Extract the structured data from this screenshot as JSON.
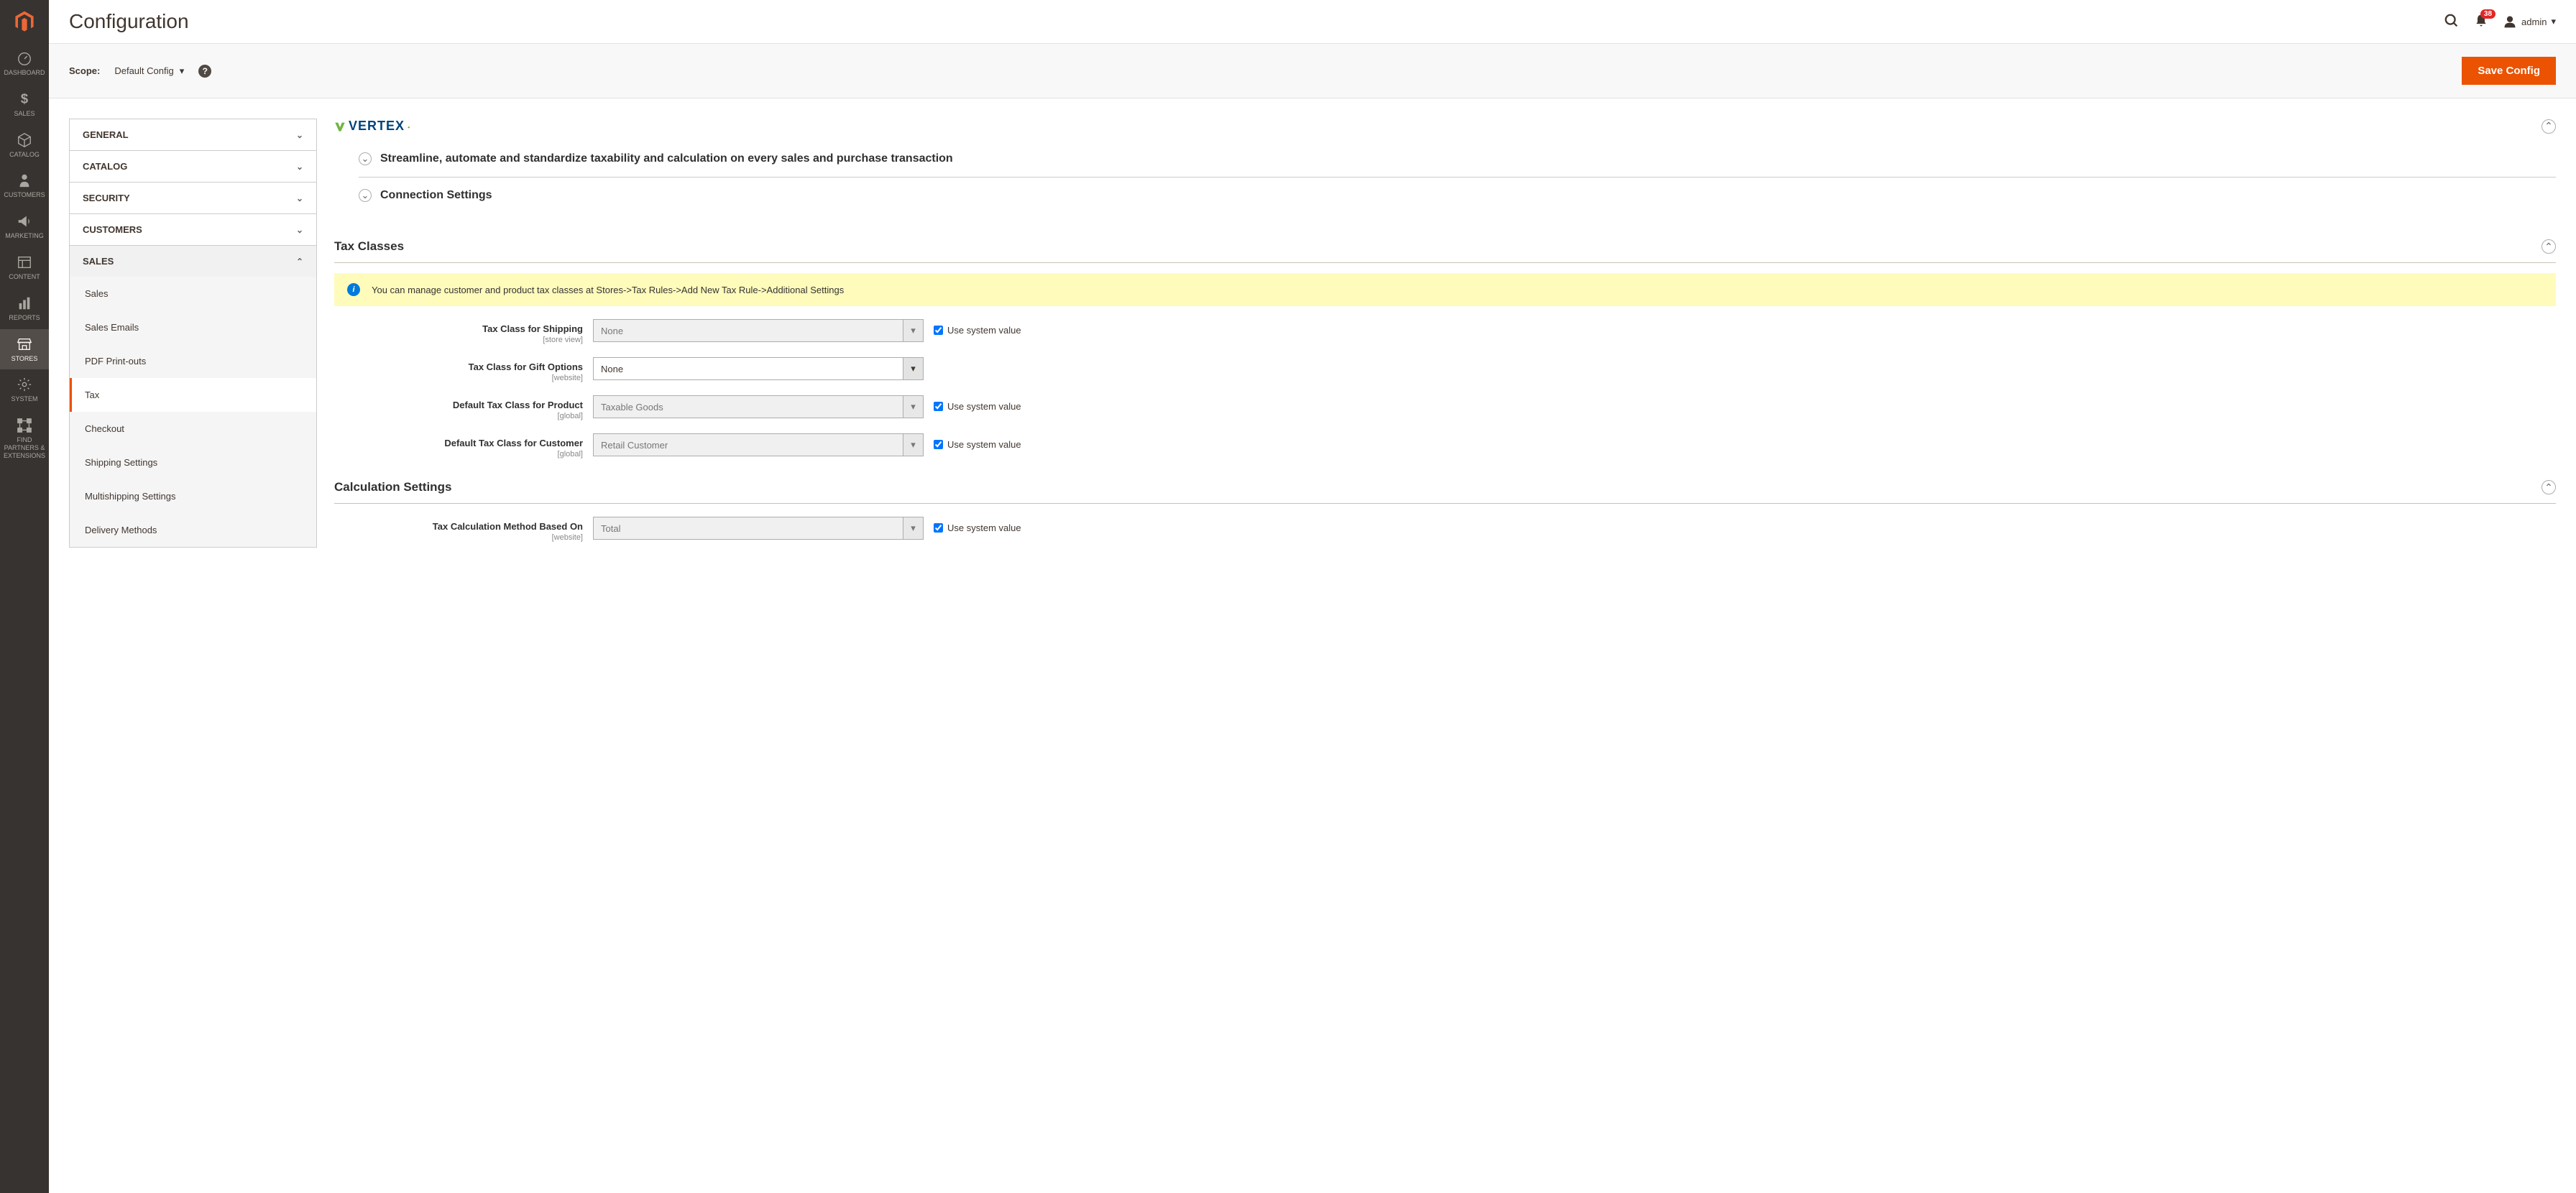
{
  "page_title": "Configuration",
  "header": {
    "notification_count": "38",
    "admin_label": "admin"
  },
  "scope": {
    "label": "Scope:",
    "value": "Default Config",
    "save_button": "Save Config"
  },
  "nav": [
    {
      "label": "DASHBOARD",
      "icon": "dashboard"
    },
    {
      "label": "SALES",
      "icon": "sales"
    },
    {
      "label": "CATALOG",
      "icon": "catalog"
    },
    {
      "label": "CUSTOMERS",
      "icon": "customers"
    },
    {
      "label": "MARKETING",
      "icon": "marketing"
    },
    {
      "label": "CONTENT",
      "icon": "content"
    },
    {
      "label": "REPORTS",
      "icon": "reports"
    },
    {
      "label": "STORES",
      "icon": "stores",
      "active": true
    },
    {
      "label": "SYSTEM",
      "icon": "system"
    },
    {
      "label": "FIND PARTNERS & EXTENSIONS",
      "icon": "partners"
    }
  ],
  "config_sections": [
    {
      "label": "GENERAL"
    },
    {
      "label": "CATALOG"
    },
    {
      "label": "SECURITY"
    },
    {
      "label": "CUSTOMERS"
    },
    {
      "label": "SALES",
      "expanded": true,
      "items": [
        {
          "label": "Sales"
        },
        {
          "label": "Sales Emails"
        },
        {
          "label": "PDF Print-outs"
        },
        {
          "label": "Tax",
          "active": true
        },
        {
          "label": "Checkout"
        },
        {
          "label": "Shipping Settings"
        },
        {
          "label": "Multishipping Settings"
        },
        {
          "label": "Delivery Methods"
        }
      ]
    }
  ],
  "vertex": {
    "brand": "VERTEX",
    "subsections": [
      "Streamline, automate and standardize taxability and calculation on every sales and purchase transaction",
      "Connection Settings"
    ]
  },
  "tax_classes": {
    "title": "Tax Classes",
    "info_message": "You can manage customer and product tax classes at Stores->Tax Rules->Add New Tax Rule->Additional Settings",
    "fields": [
      {
        "label": "Tax Class for Shipping",
        "scope": "[store view]",
        "value": "None",
        "system": true,
        "disabled": true
      },
      {
        "label": "Tax Class for Gift Options",
        "scope": "[website]",
        "value": "None",
        "system": false,
        "disabled": false
      },
      {
        "label": "Default Tax Class for Product",
        "scope": "[global]",
        "value": "Taxable Goods",
        "system": true,
        "disabled": true
      },
      {
        "label": "Default Tax Class for Customer",
        "scope": "[global]",
        "value": "Retail Customer",
        "system": true,
        "disabled": true
      }
    ]
  },
  "calc_settings": {
    "title": "Calculation Settings",
    "fields": [
      {
        "label": "Tax Calculation Method Based On",
        "scope": "[website]",
        "value": "Total",
        "system": true,
        "disabled": true
      }
    ]
  },
  "system_value_label": "Use system value"
}
